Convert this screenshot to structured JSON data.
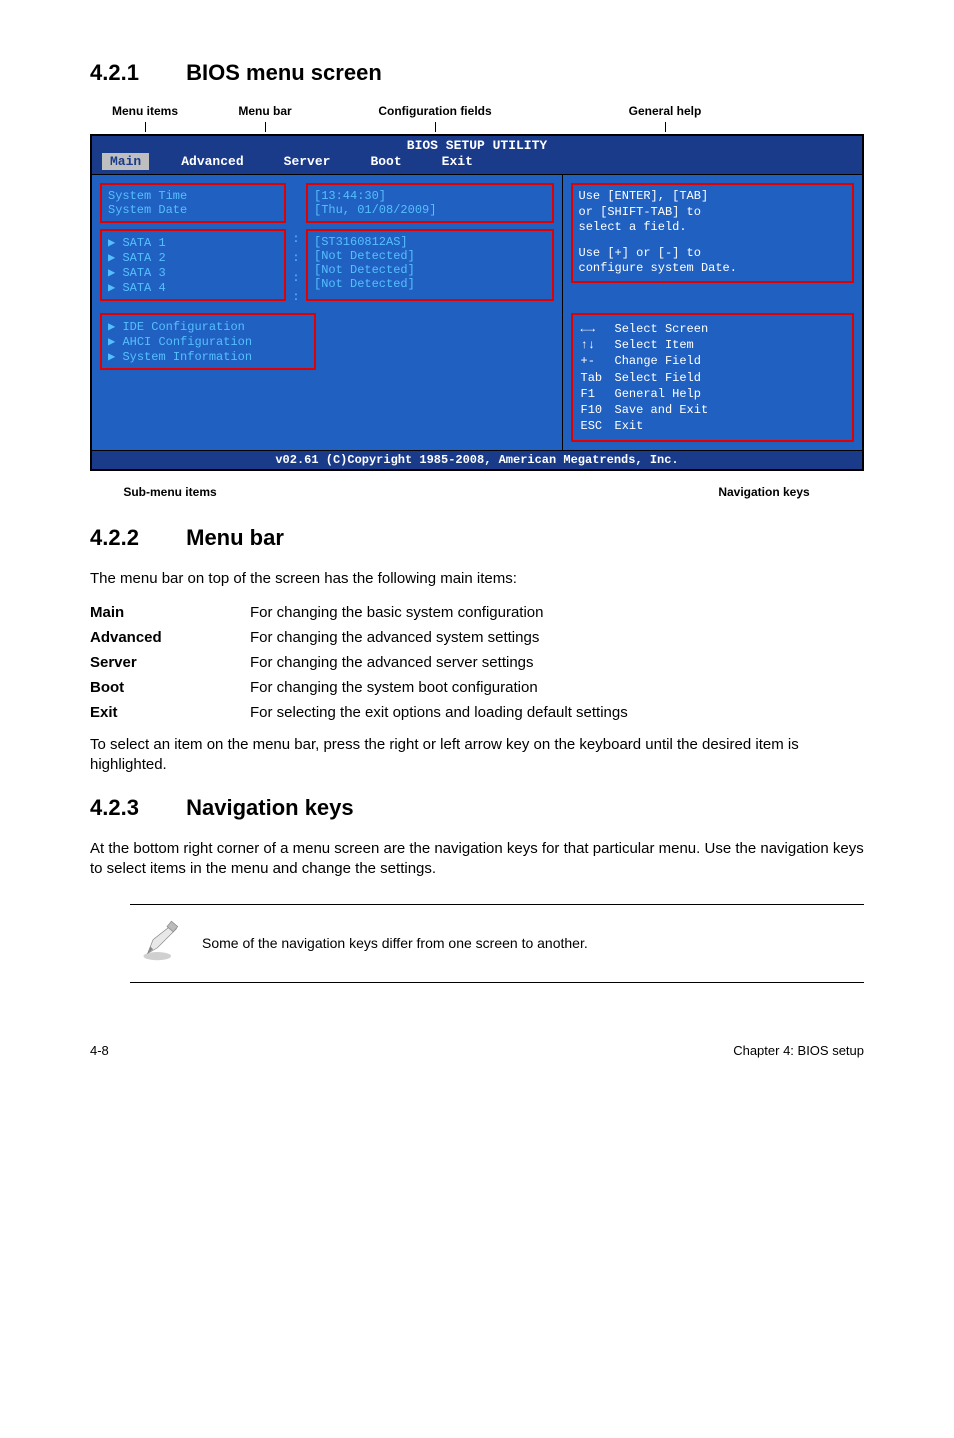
{
  "sections": {
    "s1": {
      "num": "4.2.1",
      "title": "BIOS menu screen"
    },
    "s2": {
      "num": "4.2.2",
      "title": "Menu bar"
    },
    "s3": {
      "num": "4.2.3",
      "title": "Navigation keys"
    }
  },
  "labels": {
    "menu_items": "Menu items",
    "menu_bar": "Menu bar",
    "config_fields": "Configuration fields",
    "general_help": "General help",
    "sub_menu": "Sub-menu items",
    "nav_keys": "Navigation keys"
  },
  "bios": {
    "title": "BIOS SETUP UTILITY",
    "menu": [
      "Main",
      "Advanced",
      "Server",
      "Boot",
      "Exit"
    ],
    "selected_menu": 0,
    "left": {
      "system_time_label": "System Time",
      "system_time_value": "[13:44:30]",
      "system_date_label": "System Date",
      "system_date_value": "[Thu, 01/08/2009]",
      "sata": [
        {
          "label": "SATA 1",
          "value": "[ST3160812AS]"
        },
        {
          "label": "SATA 2",
          "value": "[Not Detected]"
        },
        {
          "label": "SATA 3",
          "value": "[Not Detected]"
        },
        {
          "label": "SATA 4",
          "value": "[Not Detected]"
        }
      ],
      "submenus": [
        "IDE Configuration",
        "AHCI Configuration",
        "System Information"
      ]
    },
    "help": {
      "line1": "Use [ENTER], [TAB]",
      "line2": "or [SHIFT-TAB] to",
      "line3": "select a field.",
      "line4": "Use [+] or [-] to",
      "line5": "configure system Date."
    },
    "nav": [
      {
        "sym": "←→",
        "desc": "Select Screen"
      },
      {
        "sym": "↑↓",
        "desc": "Select Item"
      },
      {
        "sym": "+-",
        "desc": "Change Field"
      },
      {
        "sym": "Tab",
        "desc": "Select Field"
      },
      {
        "sym": "F1",
        "desc": "General Help"
      },
      {
        "sym": "F10",
        "desc": "Save and Exit"
      },
      {
        "sym": "ESC",
        "desc": "Exit"
      }
    ],
    "footer": "v02.61 (C)Copyright 1985-2008, American Megatrends, Inc."
  },
  "menubar_section": {
    "intro": "The menu bar on top of the screen has the following main items:",
    "items": [
      {
        "term": "Main",
        "desc": "For changing the basic system configuration"
      },
      {
        "term": "Advanced",
        "desc": "For changing the advanced system settings"
      },
      {
        "term": "Server",
        "desc": "For changing the advanced server settings"
      },
      {
        "term": "Boot",
        "desc": "For changing the system boot configuration"
      },
      {
        "term": "Exit",
        "desc": "For selecting the exit options and loading default settings"
      }
    ],
    "outro": "To select an item on the menu bar, press the right or left arrow key on the keyboard until the desired item is highlighted."
  },
  "navkeys_section": {
    "text": "At the bottom right corner of a menu screen are the navigation keys for that particular menu. Use the navigation keys to select items in the menu and change the settings."
  },
  "note": "Some of the navigation keys differ from one screen to another.",
  "footer": {
    "left": "4-8",
    "right": "Chapter 4: BIOS setup"
  }
}
